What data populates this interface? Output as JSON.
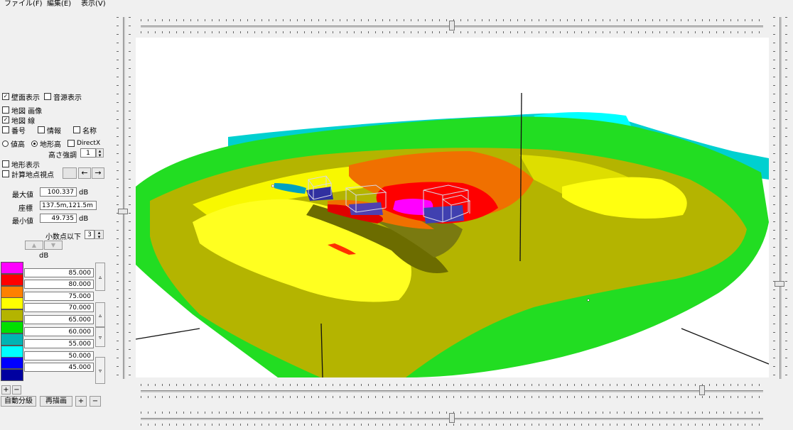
{
  "menu": {
    "file": "ファイル(F)",
    "edit": "編集(E)",
    "view": "表示(V)"
  },
  "options": {
    "wall_display": "壁面表示",
    "source_display": "音源表示",
    "map_image": "地図 画像",
    "map_line": "地図 線",
    "number": "番号",
    "info": "情報",
    "name": "名称",
    "value_height": "値高",
    "terrain_height": "地形高",
    "direct": "DirectX",
    "height_adjust_label": "高さ強調",
    "height_adjust_value": "1",
    "terrain_display": "地形表示",
    "calc_point": "計算地点視点"
  },
  "stats": {
    "max_label": "最大値",
    "max_value": "100.337",
    "max_unit": "dB",
    "coord_label": "座標",
    "coord_value": "137.5m,121.5m",
    "min_label": "最小値",
    "min_value": "49.735",
    "min_unit": "dB",
    "decimal_label": "小数点以下",
    "decimal_value": "3",
    "unit": "dB"
  },
  "legend": [
    {
      "color": "#ff00ff",
      "value": "85.000"
    },
    {
      "color": "#ff0000",
      "value": "80.000"
    },
    {
      "color": "#ff8000",
      "value": "75.000"
    },
    {
      "color": "#ffff00",
      "value": "70.000"
    },
    {
      "color": "#b4b400",
      "value": "65.000"
    },
    {
      "color": "#00e000",
      "value": "60.000"
    },
    {
      "color": "#00b4b4",
      "value": "55.000"
    },
    {
      "color": "#00ffff",
      "value": "50.000"
    },
    {
      "color": "#0000ff",
      "value": "45.000"
    },
    {
      "color": "#0000a0",
      "value": ""
    }
  ],
  "buttons": {
    "plus": "+",
    "minus": "−",
    "auto_classify": "自動分級",
    "redraw": "再描画",
    "plus2": "+",
    "minus2": "−",
    "arrow_left": "←",
    "arrow_right": "→",
    "side_up": "▵",
    "side_down": "▿"
  }
}
